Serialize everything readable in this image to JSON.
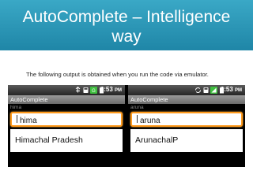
{
  "slide": {
    "title_line1": "AutoComplete – Intelligence",
    "title_line2": "way",
    "caption": "The following output is obtained when you run the code via emulator.",
    "header_color": "#2a97b8"
  },
  "screens": [
    {
      "status_time": "4:53",
      "status_ampm": "PM",
      "app_title": "AutoComplete",
      "echo_text": "hima",
      "input_value": "hima",
      "suggestion": "Himachal Pradesh"
    },
    {
      "status_time": "4:53",
      "status_ampm": "PM",
      "app_title": "AutoComplete",
      "echo_text": "aruna",
      "input_value": "aruna",
      "suggestion": "ArunachalP"
    }
  ],
  "icons": [
    "usb-icon",
    "sd-card-icon",
    "sync-icon",
    "network-3g-icon",
    "signal-icon",
    "battery-icon"
  ],
  "colors": {
    "focus_border": "#ff9a1c",
    "status_bar": "#2e2e2e",
    "app_bar": "#808080"
  }
}
